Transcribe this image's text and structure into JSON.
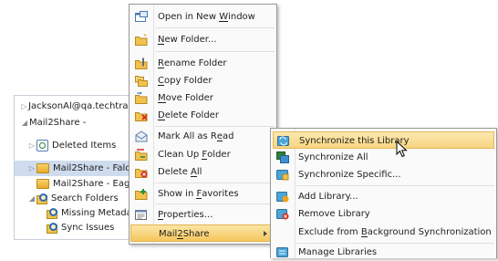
{
  "nav": {
    "rows": [
      {
        "toggle": "▷",
        "label": "JacksonAl@qa.techtra...",
        "icon": "none"
      },
      {
        "toggle": "◢",
        "label": "Mail2Share -",
        "icon": "none"
      },
      {
        "toggle": "▷",
        "label": "Deleted Items",
        "icon": "deleted-items-icon"
      },
      {
        "toggle": "▷",
        "label": "Mail2Share - Falc",
        "icon": "folder-icon"
      },
      {
        "toggle": "",
        "label": "Mail2Share - Eagl",
        "icon": "folder-icon"
      },
      {
        "toggle": "◢",
        "label": "Search Folders",
        "icon": "search-folder-icon"
      },
      {
        "toggle": "",
        "label": "Missing Metada",
        "icon": "search-folder-icon"
      },
      {
        "toggle": "",
        "label": "Sync Issues",
        "icon": "search-folder-icon"
      }
    ]
  },
  "context_menu": {
    "items": [
      {
        "pre": "Open in New ",
        "ul": "W",
        "post": "indow",
        "icon": "new-window-icon"
      },
      {
        "pre": "",
        "ul": "N",
        "post": "ew Folder...",
        "icon": "new-folder-icon"
      },
      {
        "pre": "",
        "ul": "R",
        "post": "ename Folder",
        "icon": "rename-folder-icon"
      },
      {
        "pre": "",
        "ul": "C",
        "post": "opy Folder",
        "icon": "copy-folder-icon"
      },
      {
        "pre": "",
        "ul": "M",
        "post": "ove Folder",
        "icon": "move-folder-icon"
      },
      {
        "pre": "",
        "ul": "D",
        "post": "elete Folder",
        "icon": "delete-folder-icon"
      },
      {
        "pre": "Mark All as R",
        "ul": "e",
        "post": "ad",
        "icon": "mark-read-icon"
      },
      {
        "pre": "Clean Up ",
        "ul": "F",
        "post": "older",
        "icon": "clean-up-icon"
      },
      {
        "pre": "Delete ",
        "ul": "A",
        "post": "ll",
        "icon": "delete-all-icon"
      },
      {
        "pre": "Show in ",
        "ul": "F",
        "post": "avorites",
        "icon": "favorites-icon"
      },
      {
        "pre": "",
        "ul": "P",
        "post": "roperties...",
        "icon": "properties-icon"
      },
      {
        "pre": "Mail",
        "ul": "2",
        "post": "Share",
        "icon": "none"
      }
    ]
  },
  "submenu": {
    "items": [
      {
        "pre": "Synchronize this Library",
        "ul": "",
        "post": "",
        "icon": "sync-library-icon"
      },
      {
        "pre": "Synchronize All",
        "ul": "",
        "post": "",
        "icon": "sync-all-icon"
      },
      {
        "pre": "Synchronize Specific...",
        "ul": "",
        "post": "",
        "icon": "sync-specific-icon"
      },
      {
        "pre": "Add Library...",
        "ul": "",
        "post": "",
        "icon": "add-library-icon"
      },
      {
        "pre": "Remove Library",
        "ul": "",
        "post": "",
        "icon": "remove-library-icon"
      },
      {
        "pre": "Exclude from ",
        "ul": "B",
        "post": "ackground Synchronization",
        "icon": "none"
      },
      {
        "pre": "Manage Libraries",
        "ul": "",
        "post": "",
        "icon": "manage-libraries-icon"
      }
    ]
  },
  "colors": {
    "menu_highlight": "#f6c75c",
    "nav_selected": "#cfdcee",
    "menu_border": "#979797"
  }
}
